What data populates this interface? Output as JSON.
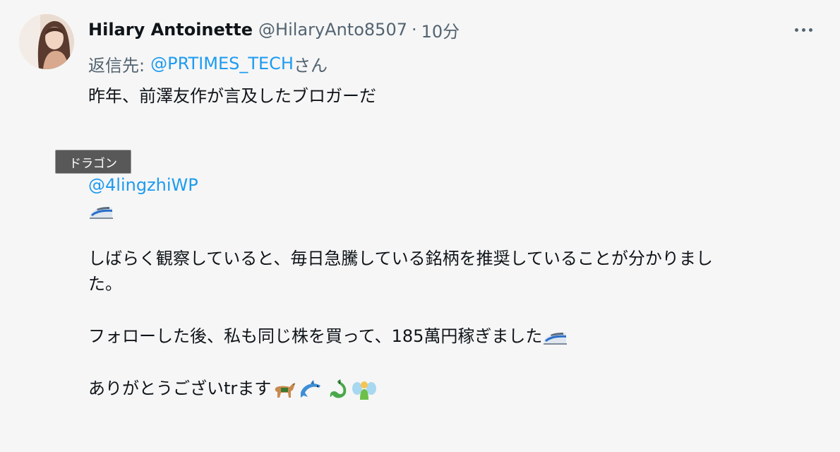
{
  "tweet": {
    "author_name": "Hilary Antoinette",
    "author_handle": "@HilaryAnto8507",
    "separator": "·",
    "timestamp": "10分",
    "reply_prefix": "返信先:",
    "reply_to": "@PRTIMES_TECH",
    "reply_suffix": "さん",
    "lines": {
      "l1": "昨年、前澤友作が言及したブロガーだ",
      "mention": "@4lingzhiWP",
      "l3a": "しばらく観察していると、毎日急騰している銘柄を推奨していることが分かりまし",
      "l3b": "た。",
      "l4": "フォローした後、私も同じ株を買って、185萬円稼ぎました",
      "l5": "ありがとうございtrます"
    }
  },
  "tooltip": {
    "text": "ドラゴン"
  },
  "icons": {
    "more": "more-dots-icon",
    "train": "bullet-train-emoji",
    "dog": "service-dog-emoji",
    "dolphin": "dolphin-emoji",
    "dragon": "dragon-emoji",
    "fairy": "fairy-emoji"
  },
  "colors": {
    "link": "#1d9bf0",
    "secondary_text": "#536471",
    "background": "#f6f6f6"
  }
}
